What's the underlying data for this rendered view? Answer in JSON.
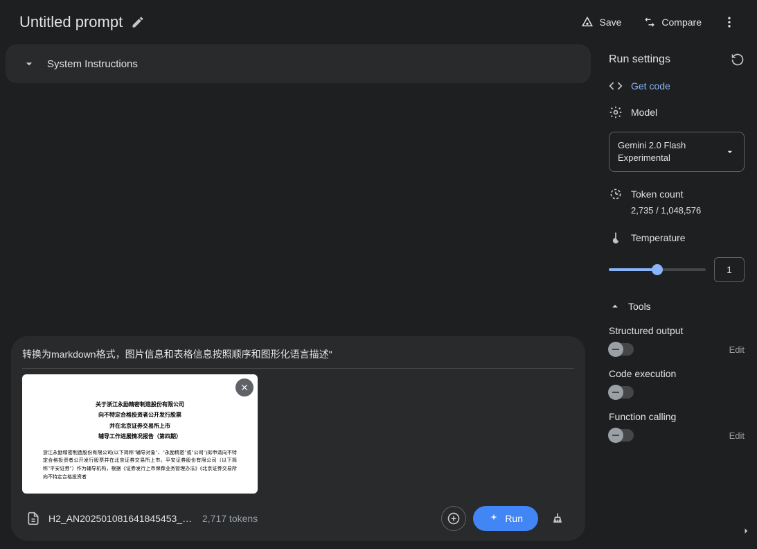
{
  "header": {
    "title": "Untitled prompt",
    "save_label": "Save",
    "compare_label": "Compare"
  },
  "system_instructions": {
    "label": "System Instructions"
  },
  "prompt": {
    "text": "转换为markdown格式，图片信息和表格信息按照顺序和图形化语言描述\"",
    "file_name": "H2_AN202501081641845453_1(...",
    "file_tokens": "2,717 tokens",
    "run_label": "Run",
    "doc_lines": {
      "l1": "关于浙江永励精密制造股份有限公司",
      "l2": "向不特定合格投资者公开发行股票",
      "l3": "并在北京证券交易所上市",
      "l4": "辅导工作进展情况报告（第四期）",
      "b1": "浙江永励精密制造股份有限公司(以下简称\"辅导对象\"、\"永励精密\"或\"公司\")拟申请向不特定合格投资者公开发行股票并在北京证券交易所上市。平安证券股份有限公司（以下简称\"平安证券\"）作为辅导机构，根据《证券发行上市保荐业务管理办法》《北京证券交易所向不特定合格投资者"
    }
  },
  "settings": {
    "title": "Run settings",
    "get_code": "Get code",
    "model_label": "Model",
    "model_name": "Gemini 2.0 Flash Experimental",
    "token_label": "Token count",
    "token_value": "2,735 / 1,048,576",
    "temp_label": "Temperature",
    "temp_value": "1",
    "tools_label": "Tools",
    "structured_output": "Structured output",
    "code_execution": "Code execution",
    "function_calling": "Function calling",
    "edit": "Edit"
  }
}
